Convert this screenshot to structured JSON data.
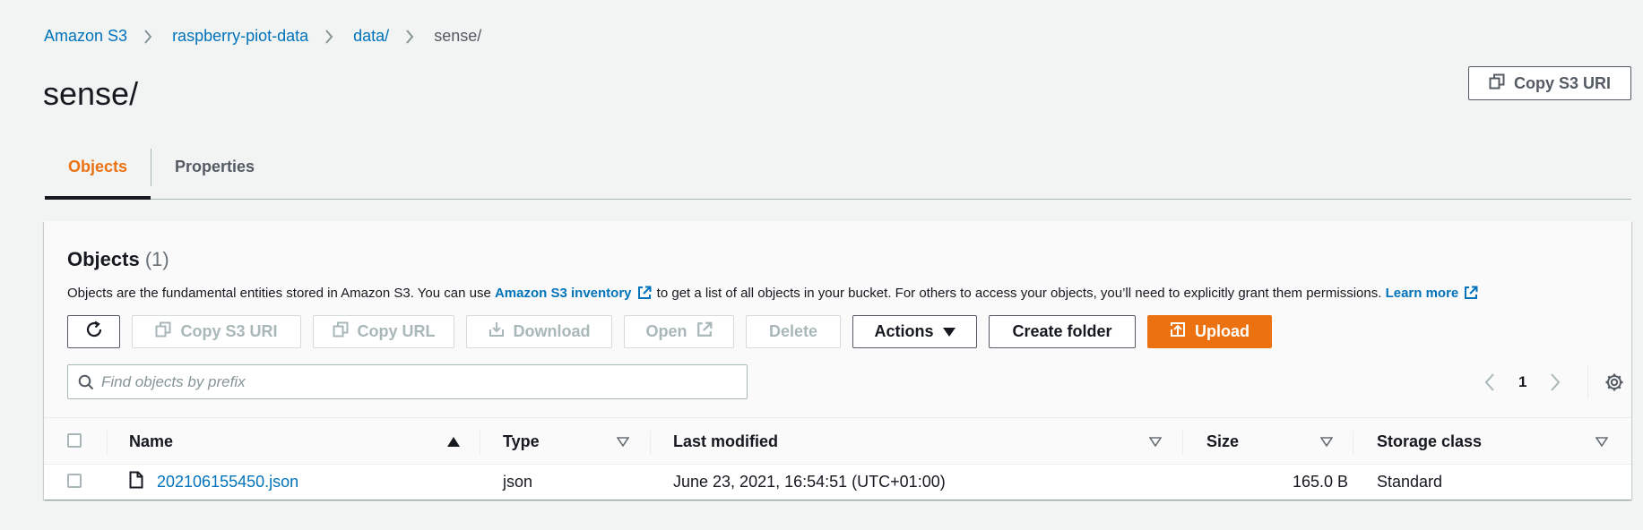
{
  "breadcrumb": {
    "items": [
      "Amazon S3",
      "raspberry-piot-data",
      "data/"
    ],
    "current": "sense/"
  },
  "page_title": "sense/",
  "copy_s3_uri_label": "Copy S3 URI",
  "tabs": [
    {
      "label": "Objects",
      "active": true
    },
    {
      "label": "Properties",
      "active": false
    }
  ],
  "objects_panel": {
    "title": "Objects",
    "count": "(1)",
    "description_prefix": "Objects are the fundamental entities stored in Amazon S3. You can use ",
    "inventory_link": "Amazon S3 inventory",
    "description_middle": " to get a list of all objects in your bucket. For others to access your objects, you’ll need to explicitly grant them permissions. ",
    "learn_more_link": "Learn more",
    "actions": {
      "refresh": "refresh-icon",
      "copy_s3_uri": "Copy S3 URI",
      "copy_url": "Copy URL",
      "download": "Download",
      "open": "Open",
      "delete": "Delete",
      "actions": "Actions",
      "create_folder": "Create folder",
      "upload": "Upload"
    },
    "search_placeholder": "Find objects by prefix",
    "pagination": {
      "current_page": "1"
    }
  },
  "table": {
    "columns": {
      "name": "Name",
      "type": "Type",
      "last_modified": "Last modified",
      "size": "Size",
      "storage_class": "Storage class"
    },
    "rows": [
      {
        "name": "202106155450.json",
        "type": "json",
        "last_modified": "June 23, 2021, 16:54:51 (UTC+01:00)",
        "size": "165.0 B",
        "storage_class": "Standard"
      }
    ]
  },
  "colors": {
    "accent": "#ec7211",
    "link": "#0073bb",
    "text": "#16191f",
    "background": "#f2f3f3"
  }
}
